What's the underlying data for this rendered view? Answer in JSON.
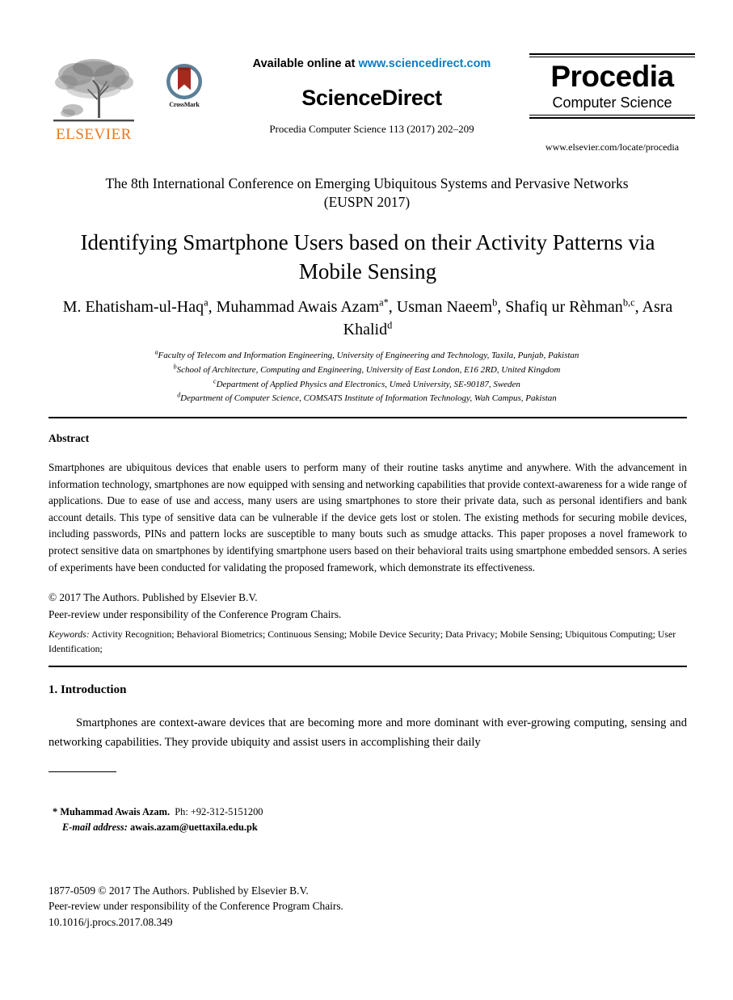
{
  "masthead": {
    "elsevier_logo_alt": "ELSEVIER",
    "elsevier_wordmark": "ELSEVIER",
    "elsevier_orange": "#E87722",
    "crossmark_label": "CrossMark",
    "crossmark_ring_color": "#5b7f96",
    "crossmark_ribbon_color": "#a52a1e",
    "available_prefix": "Available online at ",
    "available_url": "www.sciencedirect.com",
    "available_url_color": "#0b7dc4",
    "sciencedirect_wordmark": "ScienceDirect",
    "citation": "Procedia Computer Science 113 (2017) 202–209",
    "procedia_main": "Procedia",
    "procedia_sub": "Computer Science",
    "procedia_url": "www.elsevier.com/locate/procedia"
  },
  "conference": {
    "line1": "The 8th International Conference on Emerging Ubiquitous Systems and Pervasive Networks",
    "line2": "(EUSPN 2017)"
  },
  "paper": {
    "title": "Identifying Smartphone Users based on their Activity Patterns via Mobile Sensing"
  },
  "authors": {
    "list": [
      {
        "name": "M. Ehatisham-ul-Haq",
        "sup": "a",
        "sep": ", "
      },
      {
        "name": "Muhammad Awais Azam",
        "sup": "a*",
        "sep": ", "
      },
      {
        "name": "Usman Naeem",
        "sup": "b",
        "sep": ", "
      },
      {
        "name": "Shafiq ur Rèhman",
        "sup": "b,c",
        "sep": ", "
      },
      {
        "name": "Asra Khalid",
        "sup": "d",
        "sep": ""
      }
    ]
  },
  "affiliations": [
    {
      "marker": "a",
      "text": "Faculty of Telecom and Information Engineering, University of Engineering and Technology, Taxila, Punjab, Pakistan"
    },
    {
      "marker": "b",
      "text": "School of Architecture, Computing and Engineering, University of East London, E16 2RD, United Kingdom"
    },
    {
      "marker": "c",
      "text": "Department of Applied Physics and Electronics, Umeå University, SE-90187, Sweden"
    },
    {
      "marker": "d",
      "text": "Department of Computer Science, COMSATS Institute of Information Technology, Wah Campus, Pakistan"
    }
  ],
  "abstract": {
    "heading": "Abstract",
    "body": "Smartphones are ubiquitous devices that enable users to perform many of their routine tasks anytime and anywhere. With the advancement in information technology, smartphones are now equipped with sensing and networking capabilities that provide context-awareness for a wide range of applications. Due to ease of use and access, many users are using smartphones to store their private data, such as personal identifiers and bank account details. This type of sensitive data can be vulnerable if the device gets lost or stolen. The existing methods for securing mobile devices, including passwords, PINs and pattern locks are susceptible to many bouts such as smudge attacks. This paper proposes a novel framework to protect sensitive data on smartphones by identifying smartphone users based on their behavioral traits using smartphone embedded sensors. A series of experiments have been conducted for validating the proposed framework, which demonstrate its effectiveness."
  },
  "copyright": {
    "line1": "© 2017 The Authors. Published by Elsevier B.V.",
    "line2": "Peer-review under responsibility of the Conference Program Chairs."
  },
  "keywords": {
    "label": "Keywords:",
    "text": " Activity Recognition; Behavioral Biometrics; Continuous Sensing; Mobile Device Security; Data Privacy; Mobile Sensing; Ubiquitous Computing; User Identification;"
  },
  "introduction": {
    "heading": "1. Introduction",
    "body": "Smartphones are context-aware devices that are becoming more and more dominant with ever-growing computing, sensing and networking capabilities. They provide ubiquity and assist users in accomplishing their daily"
  },
  "footnote": {
    "star": "*",
    "name": "Muhammad Awais Azam.",
    "phone": "Ph: +92-312-5151200",
    "email_label": "E-mail address:",
    "email": "awais.azam@uettaxila.edu.pk"
  },
  "bottom": {
    "line1": "1877-0509 © 2017 The Authors. Published by Elsevier B.V.",
    "line2": "Peer-review under responsibility of the Conference Program Chairs.",
    "line3": "10.1016/j.procs.2017.08.349"
  }
}
